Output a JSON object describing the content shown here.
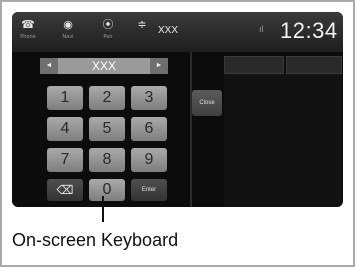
{
  "status_bar": {
    "icons": [
      {
        "name": "phone-icon",
        "glyph": "☎",
        "label": "Phone"
      },
      {
        "name": "navi-icon",
        "glyph": "◉",
        "label": "Navi"
      },
      {
        "name": "hands-free-icon",
        "glyph": "⦿",
        "label": "Pair"
      },
      {
        "name": "signal-icon",
        "glyph": "≑",
        "label": ""
      }
    ],
    "caller": "XXX",
    "clock": "12:34",
    "status_indicator": "ıl"
  },
  "dial_entry": {
    "value": "XXX",
    "left_arrow": "◄",
    "right_arrow": "►"
  },
  "keypad": {
    "rows": [
      [
        "1",
        "2",
        "3"
      ],
      [
        "4",
        "5",
        "6"
      ],
      [
        "7",
        "8",
        "9"
      ]
    ],
    "backspace": "⌫",
    "zero": "0",
    "enter": "Enter"
  },
  "close_label": "Close",
  "caption": "On-screen Keyboard",
  "colors": {
    "accent": "#a8a8a8",
    "screen_bg": "#0c0c0c"
  }
}
